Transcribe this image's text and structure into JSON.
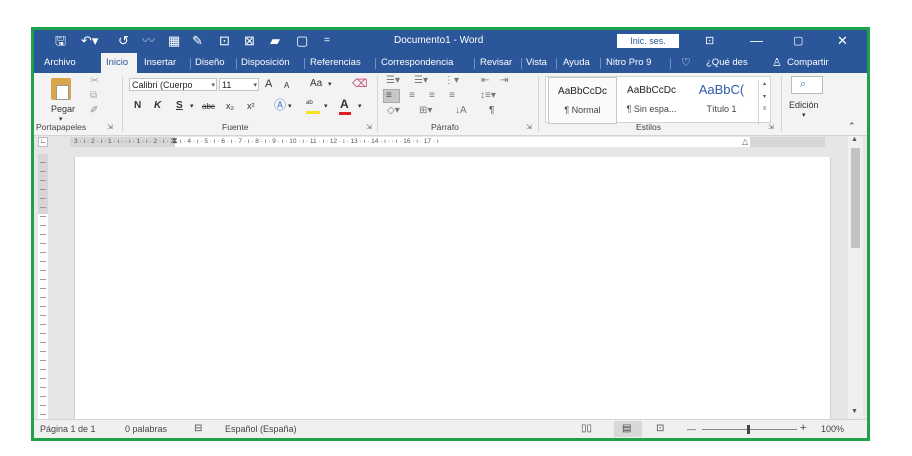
{
  "titlebar": {
    "document_title": "Documento1  -  Word",
    "sign_in": "Inic. ses."
  },
  "tabs": [
    {
      "label": "Archivo"
    },
    {
      "label": "Inicio",
      "active": true
    },
    {
      "label": "Insertar"
    },
    {
      "label": "Diseño"
    },
    {
      "label": "Disposición"
    },
    {
      "label": "Referencias"
    },
    {
      "label": "Correspondencia"
    },
    {
      "label": "Revisar"
    },
    {
      "label": "Vista"
    },
    {
      "label": "Ayuda"
    },
    {
      "label": "Nitro Pro 9"
    }
  ],
  "tell_me": "¿Qué des",
  "share": "Compartir",
  "ribbon": {
    "clipboard": {
      "label": "Portapapeles",
      "paste": "Pegar"
    },
    "font": {
      "label": "Fuente",
      "font_name": "Calibri (Cuerpo",
      "font_size": "11",
      "bold": "N",
      "italic": "K",
      "underline": "S",
      "strike": "abc",
      "subscript": "x₂",
      "superscript": "x²",
      "grow": "A",
      "shrink": "A",
      "case": "Aa"
    },
    "paragraph": {
      "label": "Párrafo",
      "pilcrow": "¶"
    },
    "styles": {
      "label": "Estilos",
      "items": [
        {
          "preview": "AaBbCcDc",
          "name": "¶ Normal"
        },
        {
          "preview": "AaBbCcDc",
          "name": "¶ Sin espa..."
        },
        {
          "preview": "AaBbC(",
          "name": "Título 1"
        }
      ]
    },
    "editing": {
      "label": "Edición"
    }
  },
  "ruler": {
    "horizontal_text": "3 · ı · 2 · ı · 1 · ı ·     · ı · 1 · ı · 2 · ı · 3 · ı · 4 · ı · 5 · ı · 6 · ı · 7 · ı · 8 · ı · 9 · ı · 10 · ı · 11 · ı · 12 · ı · 13 · ı · 14 · ı ·   · ı · 16 · ı · 17 · ı"
  },
  "status": {
    "page": "Página 1 de 1",
    "words": "0 palabras",
    "language": "Español (España)",
    "zoom_minus": "—",
    "zoom_plus": "+",
    "zoom": "100%",
    "zoom_level": 1.0
  },
  "colors": {
    "brand": "#2b579a",
    "frame": "#1fa34a",
    "font_color_underline": "#e02020",
    "highlight": "#f7e020"
  }
}
